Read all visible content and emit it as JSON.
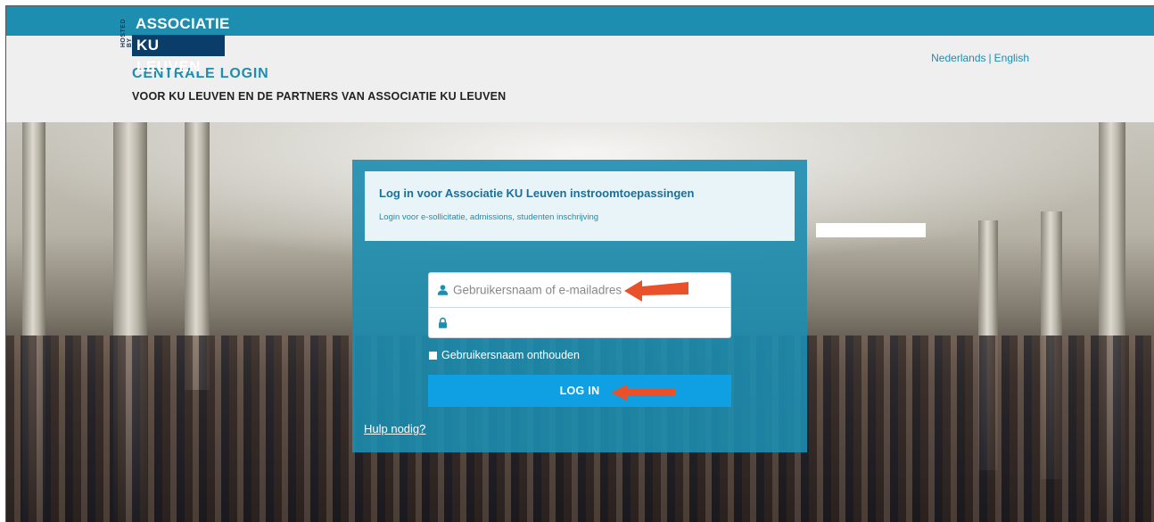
{
  "logo": {
    "hosted_by": "HOSTED BY",
    "line1": "ASSOCIATIE",
    "line2": "KU LEUVEN"
  },
  "header": {
    "title": "CENTRALE LOGIN",
    "subtitle": "VOOR KU LEUVEN EN DE PARTNERS VAN ASSOCIATIE KU LEUVEN"
  },
  "language": {
    "nl": "Nederlands",
    "separator": "|",
    "en": "English"
  },
  "panel": {
    "title": "Log in voor Associatie KU Leuven instroomtoepassingen",
    "description": "Login voor e-sollicitatie, admissions, studenten inschrijving"
  },
  "form": {
    "username_placeholder": "Gebruikersnaam of e-mailadres",
    "password_placeholder": "",
    "remember_label": "Gebruikersnaam onthouden",
    "login_label": "LOG IN",
    "help_link": "Hulp nodig?"
  },
  "colors": {
    "brand_blue": "#1d8db0",
    "dark_blue": "#0b3d6b",
    "button_blue": "#0fa0e3",
    "annotation_arrow": "#e8512a"
  },
  "icons": {
    "user": "user-icon",
    "lock": "lock-icon",
    "arrow": "annotation-arrow-icon"
  }
}
